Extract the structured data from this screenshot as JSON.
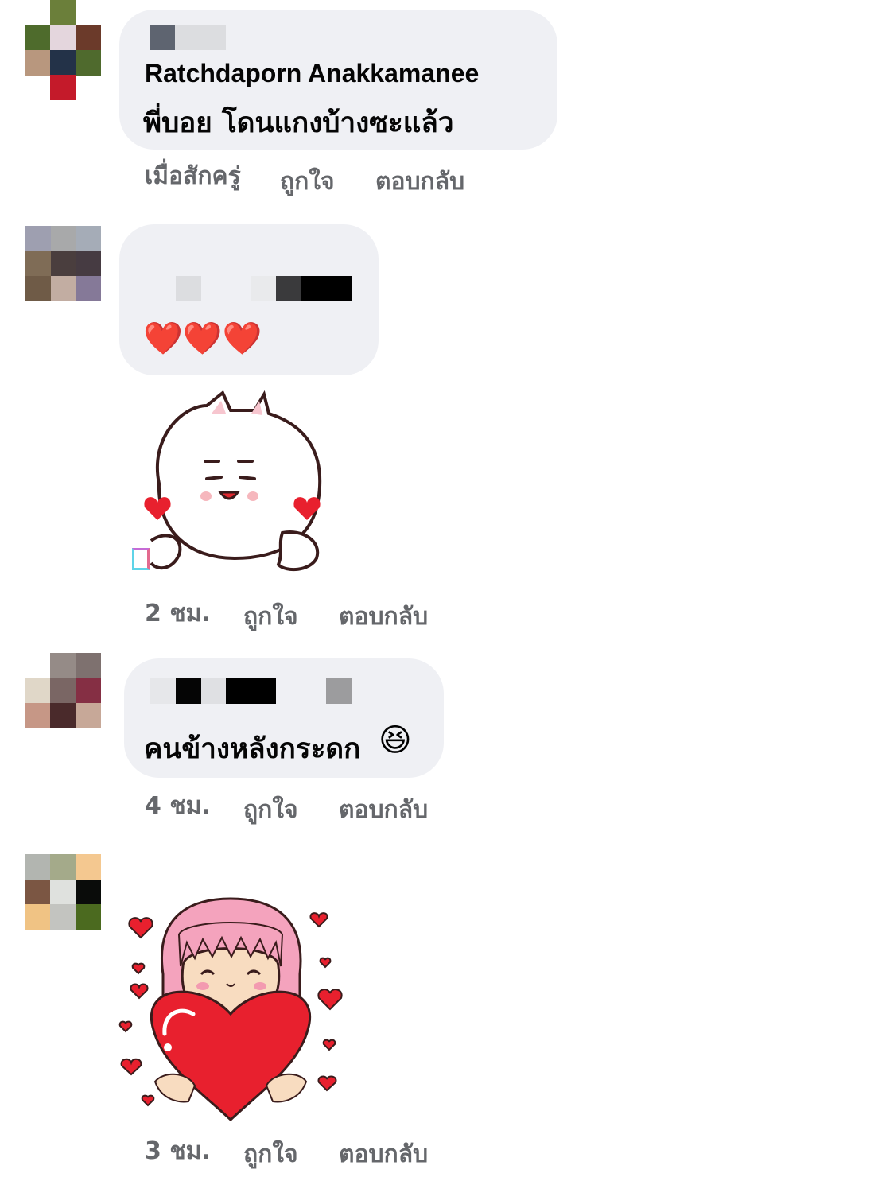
{
  "comments": [
    {
      "author": "Ratchdaporn Anakkamanee",
      "text": "พี่บอย โดนแกงบ้างซะแล้ว",
      "time": "เมื่อสักครู่",
      "like_label": "ถูกใจ",
      "reply_label": "ตอบกลับ",
      "avatar_colors": [
        "#6b7f3a",
        "#e4d6dd",
        "#6b3a2a",
        "#4e6b2c",
        "#b8977e",
        "#233248",
        "#4f6a2d",
        "#c41a2a"
      ]
    },
    {
      "author": "",
      "text": "❤️❤️❤️",
      "sticker": "white-cat-hearts-sticker",
      "time": "2 ชม.",
      "like_label": "ถูกใจ",
      "reply_label": "ตอบกลับ",
      "avatar_colors": [
        "#9e9fb0",
        "#a8a9aa",
        "#a5acb7",
        "#7f6c56",
        "#4a3e3e",
        "#463b42",
        "#6f5b47",
        "#c2ada2",
        "#857998"
      ]
    },
    {
      "author": "",
      "text": "คนข้างหลังกระดก",
      "emoji": "😆",
      "time": "4 ชม.",
      "like_label": "ถูกใจ",
      "reply_label": "ตอบกลับ",
      "avatar_colors": [
        "#958b87",
        "#7e716f",
        "#e0d7c8",
        "#7a6664",
        "#852f44",
        "#c69786",
        "#4a2a2b",
        "#c7a898"
      ]
    },
    {
      "author": "",
      "text": "",
      "sticker": "pink-hair-girl-heart-sticker",
      "time": "3 ชม.",
      "like_label": "ถูกใจ",
      "reply_label": "ตอบกลับ",
      "avatar_colors": [
        "#b2b5b0",
        "#a4aa8a",
        "#f4c890",
        "#7b5643",
        "#dfe1de",
        "#0a0c0a",
        "#f0c384",
        "#c3c4c0",
        "#4b6a1f"
      ]
    }
  ],
  "colors": {
    "bubble": "#eff0f4",
    "name_text": "#050505",
    "meta_text": "#65676b",
    "heart_red": "#e8202e"
  }
}
